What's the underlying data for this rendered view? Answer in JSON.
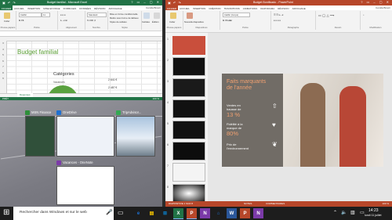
{
  "excel": {
    "title": "Budget familial - Microsoft Excel",
    "user": "Cerulia Brown",
    "tabs": [
      "FICHIER",
      "ACCUEIL",
      "INSERTION",
      "MISE EN PAGE",
      "FORMULES",
      "DONNÉES",
      "RÉVISION",
      "AFFICHAGE"
    ],
    "ribbon": {
      "paste": "Coller",
      "font_name": "Calibri",
      "font_size": "11",
      "number_format": "Standard",
      "cond_format": "Mise en forme conditionnelle",
      "table_format": "Mettre sous forme de tableau",
      "cell_styles": "Styles de cellules",
      "cells": "Cellules",
      "edit": "Édition",
      "groups": [
        "Presse-papiers",
        "Police",
        "Alignement",
        "Nombre",
        "Styles"
      ]
    },
    "heading": "Budget familial",
    "row_numbers": [
      "3",
      "4",
      "5",
      "6",
      "7",
      "8",
      "9"
    ],
    "chart_title": "Catégories",
    "category": "Vacances",
    "values": [
      "2 641 €",
      "2 487 €"
    ],
    "sheet_tab": "Dépenses",
    "status": "PRÊT",
    "zoom": "100 %"
  },
  "taskview": {
    "apps": [
      {
        "name": "MSN Finance",
        "color": "#2f8f3a"
      },
      {
        "name": "OneDrive",
        "color": "#1e6fd0"
      },
      {
        "name": "TripAdvisor...",
        "color": "#34a853"
      },
      {
        "name": "Vacances - OneNote",
        "color": "#7b3aa8"
      }
    ]
  },
  "ppt": {
    "title": "Budget Bonificado - PowerPoint",
    "user": "Cerulia Brown",
    "tabs": [
      "FICHIER",
      "ACCUEIL",
      "INSERTION",
      "CRÉATION",
      "TRANSITIONS",
      "ANIMATIONS",
      "DIAPORAMA",
      "RÉVISION",
      "AFFICHAGE"
    ],
    "ribbon": {
      "paste": "Coller",
      "new_slide": "Nouvelle diapositive",
      "font_name": "Calibri (Corps)",
      "groups": [
        "Presse-papiers",
        "Diapositives",
        "Police",
        "Paragraphe",
        "Dessin",
        "Modification"
      ]
    },
    "slide_numbers": [
      "1",
      "2",
      "3",
      "4",
      "5",
      "6",
      "7",
      "8"
    ],
    "slide": {
      "title_line1": "Faits marquants",
      "title_line2": "de l'année",
      "stat1_label1": "Ventes en",
      "stat1_label2": "hausse de",
      "stat1_value": "13 %",
      "stat2_label1": "Fidélité à la",
      "stat2_label2": "marque de",
      "stat2_value": "80%",
      "stat3_label1": "Prix de",
      "stat3_label2": "l'environnement"
    },
    "status_left": "DIAPOSITIVE 1 SUR 8",
    "notes": "NOTES",
    "comments": "COMMENTAIRES",
    "zoom": "100 %"
  },
  "taskbar": {
    "search_placeholder": "Rechercher dans Windows et sur le web",
    "apps": [
      {
        "name": "e",
        "color": "#1e73d6"
      },
      {
        "name": "▤",
        "color": "#f2c200"
      },
      {
        "name": "⊞",
        "color": "#0a84d0"
      },
      {
        "name": "X",
        "color": "#217346"
      },
      {
        "name": "P",
        "color": "#b7472a"
      },
      {
        "name": "N",
        "color": "#7b3aa8"
      },
      {
        "name": "⌂",
        "color": "#1e73d6"
      },
      {
        "name": "W",
        "color": "#2b579a"
      },
      {
        "name": "P",
        "color": "#b7472a"
      },
      {
        "name": "N",
        "color": "#7b3aa8"
      }
    ],
    "time": "14:23",
    "date": "lundi 11 juillet"
  },
  "colors": {
    "excel": "#217346",
    "powerpoint": "#b7472a",
    "taskbar": "#1d1d1d"
  }
}
